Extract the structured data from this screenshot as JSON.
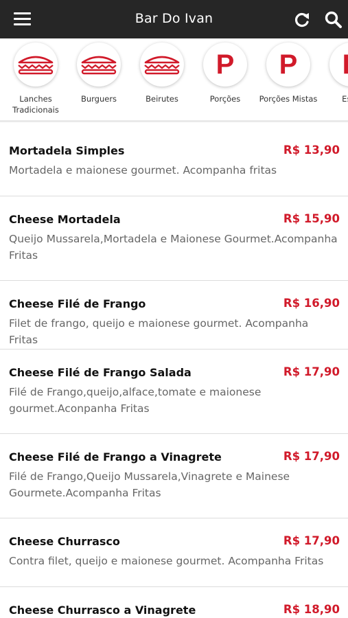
{
  "header": {
    "title": "Bar Do Ivan"
  },
  "categories": [
    {
      "label": "Lanches Tradicionais",
      "icon": "sandwich-icon"
    },
    {
      "label": "Burguers",
      "icon": "sandwich-icon"
    },
    {
      "label": "Beirutes",
      "icon": "sandwich-icon"
    },
    {
      "label": "Porções",
      "icon": "letter-p-icon",
      "letter": "P"
    },
    {
      "label": "Porções Mistas",
      "icon": "letter-p-icon",
      "letter": "P"
    },
    {
      "label": "Espe",
      "icon": "letter-p-icon",
      "letter": "P"
    }
  ],
  "items": [
    {
      "name": "Mortadela Simples",
      "price": "R$ 13,90",
      "description": "Mortadela e maionese gourmet. Acompanha fritas"
    },
    {
      "name": "Cheese Mortadela",
      "price": "R$ 15,90",
      "description": "Queijo Mussarela,Mortadela e Maionese Gourmet.Acompanha Fritas"
    },
    {
      "name": "Cheese Filé de Frango",
      "price": "R$ 16,90",
      "description": "Filet de frango, queijo e maionese gourmet. Acompanha Fritas"
    },
    {
      "name": "Cheese Filé de Frango Salada",
      "price": "R$ 17,90",
      "description": "Filé de  Frango,queijo,alface,tomate e maionese gourmet.Aconpanha Fritas"
    },
    {
      "name": "Cheese Filé de Frango a Vinagrete",
      "price": "R$ 17,90",
      "description": "Filé de Frango,Queijo Mussarela,Vinagrete e Mainese Gourmete.Acompanha Fritas"
    },
    {
      "name": "Cheese Churrasco",
      "price": "R$ 17,90",
      "description": "Contra filet, queijo e maionese gourmet. Acompanha Fritas"
    },
    {
      "name": "Cheese Churrasco a Vinagrete",
      "price": "R$ 18,90",
      "description": ""
    }
  ],
  "colors": {
    "topbar": "#262626",
    "accent": "#d11a2a",
    "description": "#666666"
  }
}
